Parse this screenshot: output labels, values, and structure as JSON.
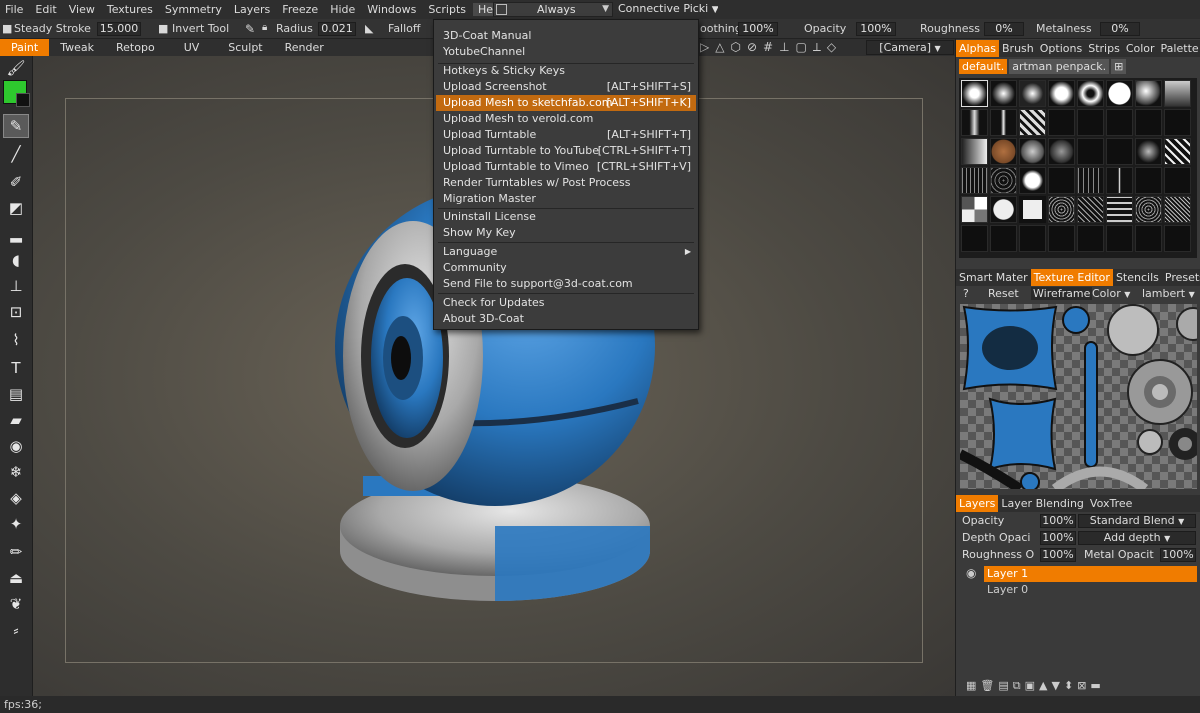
{
  "menubar": {
    "items": [
      "File",
      "Edit",
      "View",
      "Textures",
      "Symmetry",
      "Layers",
      "Freeze",
      "Hide",
      "Windows",
      "Scripts",
      "Help"
    ],
    "always_label": "Always",
    "connective_label": "Connective Picki"
  },
  "optbar": {
    "steady_stroke_label": "Steady Stroke",
    "steady_stroke_value": "15.000",
    "invert_tool_label": "Invert Tool",
    "radius_label": "Radius",
    "radius_value": "0.021",
    "falloff_label": "Falloff",
    "smoothing_label": "oothing",
    "smoothing_value": "100%",
    "opacity_label": "Opacity",
    "opacity_value": "100%",
    "roughness_label": "Roughness",
    "roughness_value": "0%",
    "metalness_label": "Metalness",
    "metalness_value": "0%",
    "camera_label": "[Camera]"
  },
  "rooms": [
    "Paint",
    "Tweak",
    "Retopo",
    "UV",
    "Sculpt",
    "Render"
  ],
  "help_menu": {
    "items": [
      {
        "label": "3D-Coat Manual",
        "shortcut": ""
      },
      {
        "label": "YotubeChannel",
        "shortcut": ""
      },
      {
        "label": "Hotkeys & Sticky Keys",
        "shortcut": ""
      },
      {
        "label": "Upload Screenshot",
        "shortcut": "[ALT+SHIFT+S]"
      },
      {
        "label": "Upload Mesh to sketchfab.com",
        "shortcut": "[ALT+SHIFT+K]"
      },
      {
        "label": "Upload Mesh to verold.com",
        "shortcut": ""
      },
      {
        "label": "Upload Turntable",
        "shortcut": "[ALT+SHIFT+T]"
      },
      {
        "label": "Upload Turntable to YouTube",
        "shortcut": "[CTRL+SHIFT+T]"
      },
      {
        "label": "Upload Turntable to Vimeo",
        "shortcut": "[CTRL+SHIFT+V]"
      },
      {
        "label": "Render Turntables w/ Post Process",
        "shortcut": ""
      },
      {
        "label": "Migration Master",
        "shortcut": ""
      },
      {
        "label": "Uninstall License",
        "shortcut": ""
      },
      {
        "label": "Show My Key",
        "shortcut": ""
      },
      {
        "label": "Language",
        "shortcut": ""
      },
      {
        "label": "Community",
        "shortcut": ""
      },
      {
        "label": "Send File to support@3d-coat.com",
        "shortcut": ""
      },
      {
        "label": "Check for Updates",
        "shortcut": ""
      },
      {
        "label": "About 3D-Coat",
        "shortcut": ""
      }
    ]
  },
  "right_panel": {
    "top_tabs": [
      "Alphas",
      "Brush",
      "Options",
      "Strips",
      "Color",
      "Palette"
    ],
    "alpha_presets": [
      "default.",
      "artman penpack."
    ],
    "mid_tabs": [
      "Smart Mater",
      "Texture Editor",
      "Stencils",
      "Presets"
    ],
    "tex_toolbar": {
      "help": "?",
      "reset": "Reset",
      "wireframe": "Wireframe",
      "color": "Color",
      "shading": "lambert"
    },
    "layer_tabs": [
      "Layers",
      "Layer Blending",
      "VoxTree"
    ],
    "layer_props": {
      "opacity_label": "Opacity",
      "opacity_value": "100%",
      "blend_mode": "Standard Blend",
      "depth_label": "Depth Opaci",
      "depth_value": "100%",
      "depth_mode": "Add depth",
      "roughness_label": "Roughness O",
      "roughness_value": "100%",
      "metal_label": "Metal Opacit",
      "metal_value": "100%"
    },
    "layers": [
      "Layer 1",
      "Layer 0"
    ]
  },
  "status": {
    "fps": "fps:36;"
  },
  "colors": {
    "accent": "#f07c00",
    "primary_color": "#2ec82e",
    "sphere_blue": "#2a78c0"
  }
}
